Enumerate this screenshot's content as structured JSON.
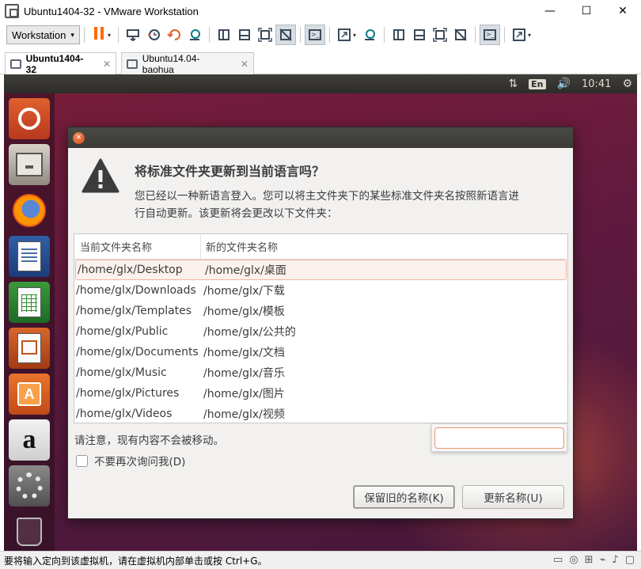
{
  "window": {
    "title": "Ubuntu1404-32 - VMware Workstation",
    "controls": {
      "minimize": "—",
      "maximize": "☐",
      "close": "✕"
    }
  },
  "toolbar": {
    "workstation_menu": "Workstation",
    "caret": "▾"
  },
  "tabs": [
    {
      "label": "Ubuntu1404-32",
      "close": "✕",
      "active": true
    },
    {
      "label": "Ubuntu14.04-baohua",
      "close": "✕",
      "active": false
    }
  ],
  "ubuntu_topbar": {
    "sort_icon": "⇅",
    "language": "En",
    "volume_icon": "🔊",
    "clock": "10:41",
    "settings_icon": "⚙"
  },
  "dialog": {
    "close_glyph": "✕",
    "heading": "将标准文件夹更新到当前语言吗？",
    "message_line1": "您已经以一种新语言登入。您可以将主文件夹下的某些标准文件夹名按照新语言进",
    "message_line2": "行自动更新。该更新将会更改以下文件夹：",
    "table": {
      "col_old": "当前文件夹名称",
      "col_new": "新的文件夹名称",
      "rows": [
        {
          "old": "/home/glx/Desktop",
          "new": "/home/glx/桌面"
        },
        {
          "old": "/home/glx/Downloads",
          "new": "/home/glx/下载"
        },
        {
          "old": "/home/glx/Templates",
          "new": "/home/glx/模板"
        },
        {
          "old": "/home/glx/Public",
          "new": "/home/glx/公共的"
        },
        {
          "old": "/home/glx/Documents",
          "new": "/home/glx/文档"
        },
        {
          "old": "/home/glx/Music",
          "new": "/home/glx/音乐"
        },
        {
          "old": "/home/glx/Pictures",
          "new": "/home/glx/图片"
        },
        {
          "old": "/home/glx/Videos",
          "new": "/home/glx/视频"
        }
      ]
    },
    "note": "请注意，现有内容不会被移动。",
    "checkbox_label": "不要再次询问我(D)",
    "checkbox_checked": false,
    "keep_button": "保留旧的名称(K)",
    "update_button": "更新名称(U)"
  },
  "launcher": {
    "software_letter": "A",
    "amazon_letter": "a"
  },
  "statusbar": {
    "text": "要将输入定向到该虚拟机，请在虚拟机内部单击或按 Ctrl+G。"
  }
}
